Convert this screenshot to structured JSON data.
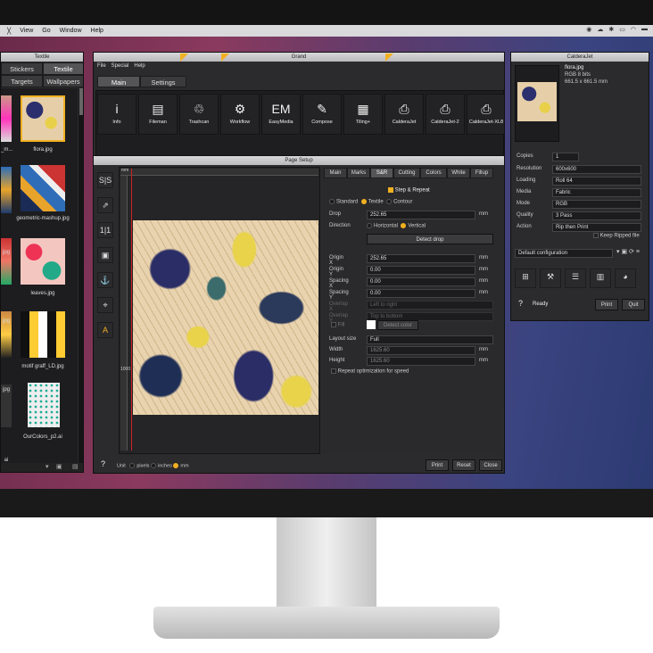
{
  "menubar": {
    "apple": "╳",
    "items": [
      "View",
      "Go",
      "Window",
      "Help"
    ]
  },
  "library": {
    "title": "Textile",
    "tabs": [
      {
        "label": "Stickers"
      },
      {
        "label": "Textile"
      },
      {
        "label": "Targets"
      },
      {
        "label": "Wallpapers"
      }
    ],
    "files": [
      {
        "name": "flora.jpg"
      },
      {
        "name": "geometric-mashup.jpg"
      },
      {
        "name": "leaves.jpg"
      },
      {
        "name": "motif graff_LD.jpg"
      },
      {
        "name": "OurColors_p2.ai"
      }
    ],
    "left_labels": [
      "_m...",
      "jpg",
      "jpg",
      "jpg",
      "ai"
    ]
  },
  "grand": {
    "title": "Grand",
    "menu": [
      "File",
      "Special",
      "Help"
    ],
    "tabs": [
      {
        "label": "Main"
      },
      {
        "label": "Settings"
      }
    ],
    "tools": [
      {
        "label": "Info",
        "icon": "i"
      },
      {
        "label": "Fileman",
        "icon": "▤"
      },
      {
        "label": "Trashcan",
        "icon": "♲"
      },
      {
        "label": "Workflow",
        "icon": "⚙"
      },
      {
        "label": "EasyMedia",
        "icon": "EM"
      },
      {
        "label": "Compose",
        "icon": "✎"
      },
      {
        "label": "Tiling+",
        "icon": "▦"
      },
      {
        "label": "CalderaJet",
        "icon": "⎙"
      },
      {
        "label": "CalderaJet-2",
        "icon": "⎙"
      },
      {
        "label": "CalderaJet-XL8",
        "icon": "⎙"
      }
    ]
  },
  "pagesetup": {
    "title": "Page Setup",
    "ruler_mm": "mm",
    "ruler_1000": "1000",
    "tabs": [
      {
        "label": "Main"
      },
      {
        "label": "Marks"
      },
      {
        "label": "S&R"
      },
      {
        "label": "Cutting"
      },
      {
        "label": "Colors"
      },
      {
        "label": "White"
      },
      {
        "label": "Fillup"
      }
    ],
    "step_repeat": "Step & Repeat",
    "mode": {
      "standard": "Standard",
      "textile": "Textile",
      "contour": "Contour"
    },
    "drop_label": "Drop",
    "drop_value": "252.65",
    "unit": "mm",
    "direction_label": "Direction",
    "dir_h": "Horizontal",
    "dir_v": "Vertical",
    "detect_drop": "Detect drop",
    "origin_x_label": "Origin X",
    "origin_x": "252.65",
    "origin_y_label": "Origin Y",
    "origin_y": "0.00",
    "spacing_x_label": "Spacing X",
    "spacing_x": "0.00",
    "spacing_y_label": "Spacing Y",
    "spacing_y": "0.00",
    "overlap_x_label": "Overlap X",
    "overlap_x": "Left to right",
    "overlap_y_label": "Overlap Y",
    "overlap_y": "Top to bottom",
    "fill_label": "Fill",
    "detect_color": "Detect color",
    "layout_size_label": "Layout size",
    "layout_size": "Full",
    "width_label": "Width",
    "width": "1625.60",
    "height_label": "Height",
    "height": "1625.60",
    "repeat_opt": "Repeat optimization for speed",
    "help": "?",
    "unit_label": "Unit",
    "unit_pixels": "pixels",
    "unit_inches": "inches",
    "unit_mm": "mm",
    "print": "Print",
    "reset": "Reset",
    "close": "Close",
    "side_tools": [
      "S|S",
      "⇗",
      "1|1",
      "▣",
      "⚓",
      "⌖",
      "A"
    ]
  },
  "calderajet": {
    "title": "CalderaJet",
    "file": "flora.jpg",
    "info1": "RGB 8 bits",
    "info2": "661.5 x 661.5 mm",
    "copies_label": "Copies",
    "copies": "1",
    "resolution_label": "Resolution",
    "resolution": "600x600",
    "loading_label": "Loading",
    "loading": "Roll 64",
    "media_label": "Media",
    "media": "Fabric",
    "mode_label": "Mode",
    "mode": "RGB",
    "quality_label": "Quality",
    "quality": "3 Pass",
    "action_label": "Action",
    "action": "Rip then Print",
    "keep_ripped": "Keep Ripped file",
    "config": "Default configuration",
    "help": "?",
    "status": "Ready",
    "print": "Print",
    "quit": "Quit"
  },
  "colors": {
    "accent": "#f1b021",
    "panel": "#2b2b2d"
  }
}
